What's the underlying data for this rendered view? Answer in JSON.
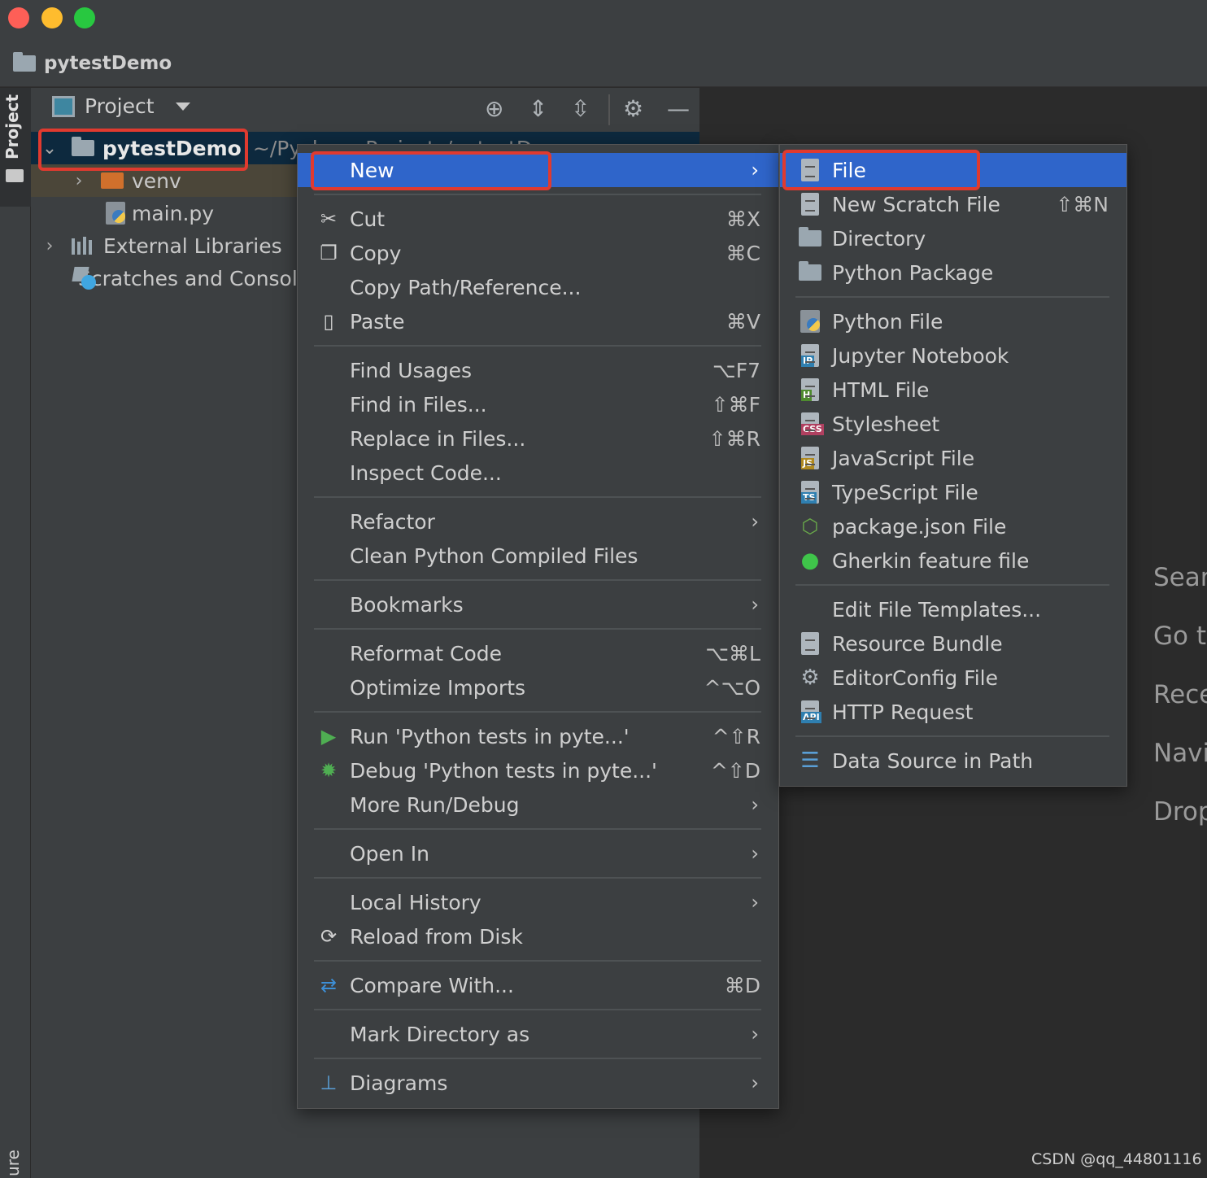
{
  "window": {
    "title": "pytestDemo"
  },
  "toolstrip": {
    "project_tab": "Project",
    "bottom_tab": "ure"
  },
  "panel": {
    "title": "Project",
    "tree": {
      "root": {
        "name": "pytestDemo",
        "path": "~/PycharmProjects/pytestDemo"
      },
      "venv": "venv",
      "main": "main.py",
      "external": "External Libraries",
      "scratches": "Scratches and Consoles"
    }
  },
  "context_menu": {
    "new": "New",
    "cut": {
      "label": "Cut",
      "shortcut": "⌘X"
    },
    "copy": {
      "label": "Copy",
      "shortcut": "⌘C"
    },
    "copy_path": "Copy Path/Reference...",
    "paste": {
      "label": "Paste",
      "shortcut": "⌘V"
    },
    "find_usages": {
      "label": "Find Usages",
      "shortcut": "⌥F7"
    },
    "find_in_files": {
      "label": "Find in Files...",
      "shortcut": "⇧⌘F"
    },
    "replace_in_files": {
      "label": "Replace in Files...",
      "shortcut": "⇧⌘R"
    },
    "inspect_code": "Inspect Code...",
    "refactor": "Refactor",
    "clean_compiled": "Clean Python Compiled Files",
    "bookmarks": "Bookmarks",
    "reformat": {
      "label": "Reformat Code",
      "shortcut": "⌥⌘L"
    },
    "optimize_imports": {
      "label": "Optimize Imports",
      "shortcut": "^⌥O"
    },
    "run": {
      "label": "Run 'Python tests in pyte...'",
      "shortcut": "^⇧R"
    },
    "debug": {
      "label": "Debug 'Python tests in pyte...'",
      "shortcut": "^⇧D"
    },
    "more_run": "More Run/Debug",
    "open_in": "Open In",
    "local_history": "Local History",
    "reload": "Reload from Disk",
    "compare": {
      "label": "Compare With...",
      "shortcut": "⌘D"
    },
    "mark_dir": "Mark Directory as",
    "diagrams": "Diagrams"
  },
  "submenu": {
    "file": "File",
    "scratch": {
      "label": "New Scratch File",
      "shortcut": "⇧⌘N"
    },
    "directory": "Directory",
    "python_package": "Python Package",
    "python_file": "Python File",
    "jupyter": "Jupyter Notebook",
    "html": "HTML File",
    "stylesheet": "Stylesheet",
    "javascript": "JavaScript File",
    "typescript": "TypeScript File",
    "package_json": "package.json File",
    "gherkin": "Gherkin feature file",
    "edit_templates": "Edit File Templates...",
    "resource_bundle": "Resource Bundle",
    "editorconfig": "EditorConfig File",
    "http_request": "HTTP Request",
    "data_source": "Data Source in Path"
  },
  "badges": {
    "ip": "IP",
    "h": "H",
    "css": "CSS",
    "js": "JS",
    "ts": "TS",
    "api": "API"
  },
  "editor_hints": [
    "Sear",
    "Go t",
    "Rece",
    "Navi",
    "Drop"
  ],
  "watermark": "CSDN @qq_44801116",
  "colors": {
    "selection": "#2f65ca",
    "highlight_box": "#e03a2f",
    "background": "#2b2b2b",
    "panel": "#3c3f41"
  }
}
